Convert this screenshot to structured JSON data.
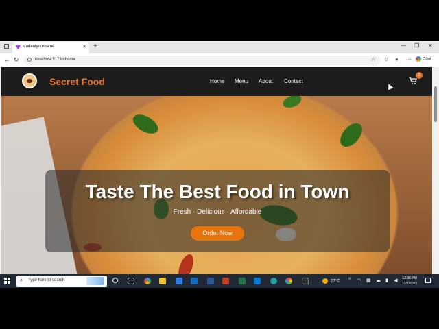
{
  "browser": {
    "tab_title": "studentyourname",
    "url": "localhost:5173/#home",
    "chat_label": "Chat"
  },
  "navbar": {
    "brand": "Secret Food",
    "links": [
      "Home",
      "Menu",
      "About",
      "Contact"
    ],
    "cart_count": "2"
  },
  "hero": {
    "title": "Taste The Best Food in Town",
    "subtitle": "Fresh · Delicious · Affordable",
    "cta": "Order Now"
  },
  "taskbar": {
    "search_placeholder": "Type here to search",
    "temperature": "27°C",
    "time": "12:38 PM",
    "date": "12/7/2025"
  },
  "colors": {
    "accent": "#e8742a",
    "button": "#e8740c",
    "navbar_bg": "#1c1c1c"
  }
}
